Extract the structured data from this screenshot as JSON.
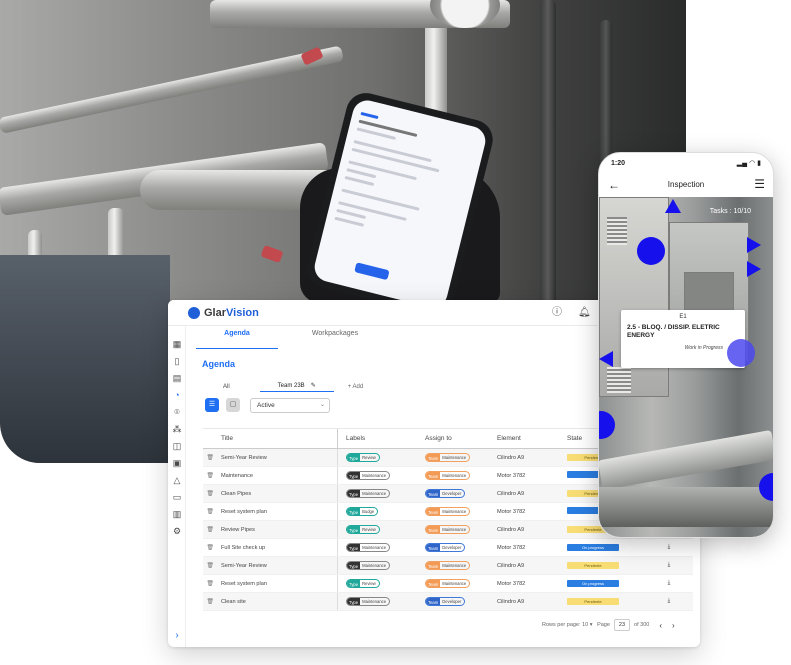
{
  "webapp": {
    "brand_pre": "Glar",
    "brand_post": "Vision",
    "tabs": [
      "Agenda",
      "Workpackages"
    ],
    "page_title": "Agenda",
    "filter_tabs": {
      "all": "All",
      "team": "Team 23B",
      "add": "+ Add"
    },
    "status_select": "Active",
    "columns": [
      "Title",
      "Labels",
      "Assign to",
      "Element",
      "State"
    ],
    "rows": [
      {
        "title": "Semi-Year Review",
        "label_k": "Type",
        "label_v": "Review",
        "label_c": "teal",
        "assign_k": "Team",
        "assign_v": "Maintenance",
        "assign_c": "org",
        "element": "Cilindro A9",
        "state": "Pendente",
        "state_c": "pend"
      },
      {
        "title": "Maintenance",
        "label_k": "Type",
        "label_v": "Maintenance",
        "label_c": "gray",
        "assign_k": "Team",
        "assign_v": "Maintenance",
        "assign_c": "org",
        "element": "Motor 3782",
        "state": "",
        "state_c": "prog"
      },
      {
        "title": "Clean Pipes",
        "label_k": "Type",
        "label_v": "Maintenance",
        "label_c": "gray",
        "assign_k": "Team",
        "assign_v": "Developer",
        "assign_c": "blu",
        "element": "Cilindro A9",
        "state": "Pendente",
        "state_c": "pend"
      },
      {
        "title": "Reset system plan",
        "label_k": "Type",
        "label_v": "Budge",
        "label_c": "teal",
        "assign_k": "Team",
        "assign_v": "Maintenance",
        "assign_c": "org",
        "element": "Motor 3782",
        "state": "",
        "state_c": "prog"
      },
      {
        "title": "Review Pipes",
        "label_k": "Type",
        "label_v": "Review",
        "label_c": "teal",
        "assign_k": "Team",
        "assign_v": "Maintenance",
        "assign_c": "org",
        "element": "Cilindro A9",
        "state": "Pendente",
        "state_c": "pend"
      },
      {
        "title": "Full Site check up",
        "label_k": "Type",
        "label_v": "Maintenance",
        "label_c": "gray",
        "assign_k": "Team",
        "assign_v": "Developer",
        "assign_c": "blu",
        "element": "Motor 3782",
        "state": "On progress",
        "state_c": "prog"
      },
      {
        "title": "Semi-Year Review",
        "label_k": "Type",
        "label_v": "Maintenance",
        "label_c": "gray",
        "assign_k": "Team",
        "assign_v": "Maintenance",
        "assign_c": "org",
        "element": "Cilindro A9",
        "state": "Pendente",
        "state_c": "pend"
      },
      {
        "title": "Reset system plan",
        "label_k": "Type",
        "label_v": "Review",
        "label_c": "teal",
        "assign_k": "Team",
        "assign_v": "Maintenance",
        "assign_c": "org",
        "element": "Motor 3782",
        "state": "On progress",
        "state_c": "prog"
      },
      {
        "title": "Clean site",
        "label_k": "Type",
        "label_v": "Maintenance",
        "label_c": "gray",
        "assign_k": "Team",
        "assign_v": "Developer",
        "assign_c": "blu",
        "element": "Cilindro A9",
        "state": "Pendente",
        "state_c": "pend"
      }
    ],
    "pager": {
      "rows_label": "Rows per page:",
      "rows_value": "10",
      "page_label": "Page",
      "page_value": "23",
      "of_label": "of 300"
    }
  },
  "inspection": {
    "time": "1:20",
    "title": "Inspection",
    "tasks": "Tasks : 10/10",
    "card_id": "E1",
    "card_title": "2.5 - BLOQ. / DISSIP. ELETRIC ENERGY",
    "card_status": "Work in Progress"
  },
  "icons": [
    "info-icon",
    "bell-icon",
    "back-arrow-icon",
    "menu-icon",
    "download-icon",
    "trash-icon",
    "pencil-icon"
  ],
  "colors": {
    "primary": "#1f6ff3",
    "pin": "#1611ec",
    "pending": "#f8dc74",
    "progress": "#2a7de1"
  }
}
